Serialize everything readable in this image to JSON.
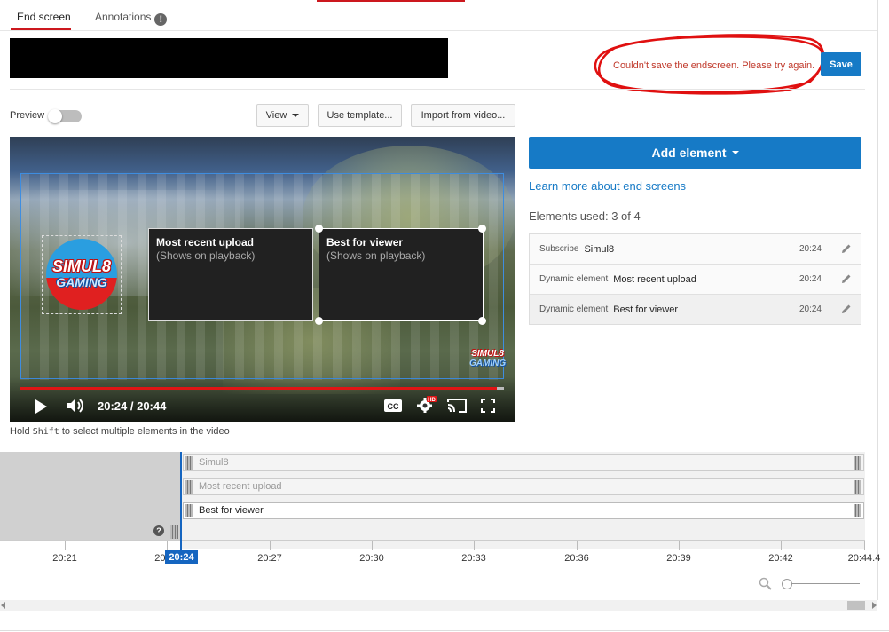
{
  "tabs": [
    {
      "label": "End screen",
      "active": true
    },
    {
      "label": "Annotations",
      "active": false,
      "badge": "!"
    }
  ],
  "header": {
    "error_message": "Couldn't save the endscreen. Please try again.",
    "save_label": "Save"
  },
  "toolbar": {
    "preview_label": "Preview",
    "preview_on": false,
    "view_label": "View",
    "template_label": "Use template...",
    "import_label": "Import from video..."
  },
  "video": {
    "elements": [
      {
        "title": "Most recent upload",
        "subtitle": "(Shows on playback)"
      },
      {
        "title": "Best for viewer",
        "subtitle": "(Shows on playback)"
      }
    ],
    "logo_line1": "SIMUL8",
    "logo_line2": "GAMING",
    "time_display": "20:24 / 20:44",
    "progress": 0.985
  },
  "hint": {
    "before": "Hold ",
    "key": "Shift",
    "after": " to select multiple elements in the video"
  },
  "panel": {
    "add_element_label": "Add element",
    "learn_more": "Learn more about end screens",
    "elements_used": "Elements used: 3 of 4",
    "rows": [
      {
        "type": "Subscribe",
        "name": "Simul8",
        "time": "20:24"
      },
      {
        "type": "Dynamic element",
        "name": "Most recent upload",
        "time": "20:24"
      },
      {
        "type": "Dynamic element",
        "name": "Best for viewer",
        "time": "20:24"
      }
    ]
  },
  "timeline": {
    "tracks": [
      "Simul8",
      "Most recent upload",
      "Best for viewer"
    ],
    "help_icon": "?",
    "current_time": "20:24",
    "ticks": [
      "20:21",
      "20:24",
      "20:27",
      "20:30",
      "20:33",
      "20:36",
      "20:39",
      "20:42",
      "20:44.4"
    ]
  },
  "colors": {
    "accent": "#167ac6",
    "error": "#c0392b",
    "playhead": "#1565c0",
    "tab_underline": "#cc181e"
  },
  "icons": [
    "warning-icon",
    "play-icon",
    "volume-icon",
    "cc-icon",
    "settings-hd-icon",
    "cast-icon",
    "fullscreen-icon",
    "pencil-icon",
    "help-icon",
    "zoom-icon"
  ]
}
